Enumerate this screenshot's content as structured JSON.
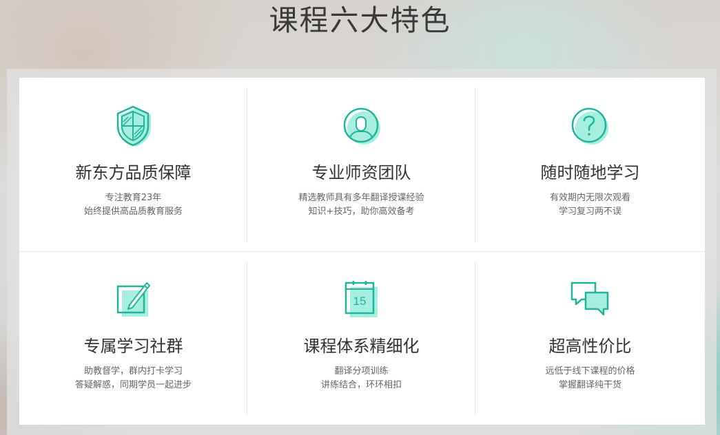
{
  "page_title": "课程六大特色",
  "features": [
    {
      "icon": "shield-icon",
      "title": "新东方品质保障",
      "lines": [
        "专注教育23年",
        "始终提供高品质教育服务"
      ]
    },
    {
      "icon": "teacher-avatar-icon",
      "title": "专业师资团队",
      "lines": [
        "精选教师具有多年翻译授课经验",
        "知识+技巧，助你高效备考"
      ]
    },
    {
      "icon": "question-icon",
      "title": "随时随地学习",
      "lines": [
        "有效期内无限次观看",
        "学习复习两不误"
      ]
    },
    {
      "icon": "edit-note-icon",
      "title": "专属学习社群",
      "lines": [
        "助教督学，群内打卡学习",
        "答疑解惑，同期学员一起进步"
      ]
    },
    {
      "icon": "calendar-icon",
      "title": "课程体系精细化",
      "calendar_day": "15",
      "lines": [
        "翻译分项训练",
        "讲练结合，环环相扣"
      ]
    },
    {
      "icon": "chat-bubbles-icon",
      "title": "超高性价比",
      "lines": [
        "远低于线下课程的价格",
        "掌握翻译纯干货"
      ]
    }
  ],
  "colors": {
    "accent_stroke": "#1fb59a",
    "accent_fill": "#a6eee0",
    "title_text": "#333333",
    "desc_text": "#666666"
  }
}
